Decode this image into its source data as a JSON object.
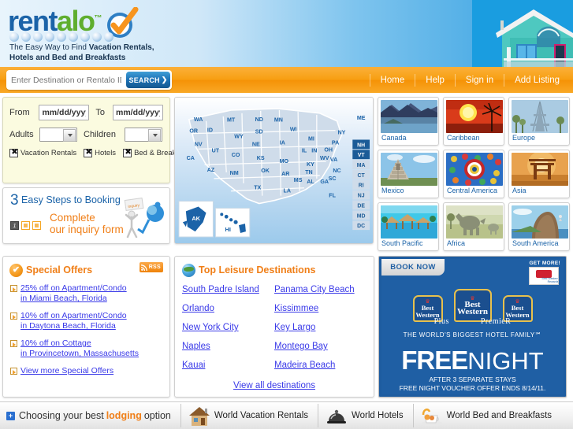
{
  "brand": {
    "logo_text_1": "rent",
    "logo_text_2": "alo",
    "logo_tm": "™",
    "tagline_line1": "The Easy Way to Find ",
    "tagline_bold1": "Vacation Rentals,",
    "tagline_line2": "Hotels and Bed and Breakfasts",
    "accent_orange": "#f07f18",
    "accent_blue": "#1b63a8",
    "accent_green": "#5fae2e",
    "link_blue": "#3a3ae8"
  },
  "nav": {
    "search_placeholder": "Enter Destination or Rentalo ID",
    "search_value": "",
    "search_button": "SEARCH",
    "search_arrow": "❯",
    "links": [
      {
        "label": "Home"
      },
      {
        "label": "Help"
      },
      {
        "label": "Sign in"
      },
      {
        "label": "Add Listing"
      }
    ]
  },
  "search_form": {
    "from_label": "From",
    "from_value": "mm/dd/yyyy",
    "to_label": "To",
    "to_value": "mm/dd/yyyy",
    "adults_label": "Adults",
    "adults_value": "",
    "children_label": "Children",
    "children_value": "",
    "checkboxes": [
      {
        "label": "Vacation Rentals",
        "checked": true
      },
      {
        "label": "Hotels",
        "checked": true
      },
      {
        "label": "Bed & Breakfast",
        "checked": true
      }
    ]
  },
  "steps": {
    "number": "3",
    "title": " Easy Steps to Booking",
    "text_line1": "Complete",
    "text_line2": "our inquiry form",
    "current_step": "1",
    "total_steps": 3,
    "art_label": "inquiry"
  },
  "map": {
    "states": [
      "WA",
      "OR",
      "ID",
      "MT",
      "ND",
      "MN",
      "WI",
      "MI",
      "NY",
      "ME",
      "WY",
      "SD",
      "IA",
      "IL",
      "IN",
      "OH",
      "PA",
      "NV",
      "NE",
      "UT",
      "CO",
      "KS",
      "MO",
      "KY",
      "WV",
      "VA",
      "NC",
      "CA",
      "AZ",
      "NM",
      "OK",
      "AR",
      "TN",
      "SC",
      "TX",
      "LA",
      "MS",
      "AL",
      "GA",
      "FL"
    ],
    "small_states": [
      "NH",
      "VT",
      "MA",
      "CT",
      "RI",
      "NJ",
      "DE",
      "MD",
      "DC"
    ],
    "insets": [
      "AK",
      "HI"
    ]
  },
  "destinations_grid": [
    {
      "label": "Canada"
    },
    {
      "label": "Caribbean"
    },
    {
      "label": "Europe"
    },
    {
      "label": "Mexico"
    },
    {
      "label": "Central America"
    },
    {
      "label": "Asia"
    },
    {
      "label": "South Pacific"
    },
    {
      "label": "Africa"
    },
    {
      "label": "South America"
    }
  ],
  "special_offers": {
    "title": "Special Offers",
    "rss_label": "RSS",
    "items": [
      {
        "line1": "25% off on Apartment/Condo",
        "line2": "in Miami Beach, Florida"
      },
      {
        "line1": "10% off on Apartment/Condo",
        "line2": "in Daytona Beach, Florida"
      },
      {
        "line1": "10% off on Cottage",
        "line2": "in Provincetown, Massachusetts"
      },
      {
        "line1": "View more Special Offers",
        "line2": ""
      }
    ]
  },
  "leisure": {
    "title": "Top Leisure Destinations",
    "col1": [
      "South Padre Island",
      "Orlando",
      "New York City",
      "Naples",
      "Kauai"
    ],
    "col2": [
      "Panama City Beach",
      "Kissimmee",
      "Key Largo",
      "Montego Bay",
      "Madeira Beach"
    ],
    "view_all": "View all destinations"
  },
  "ad": {
    "book_now": "BOOK NOW",
    "get_more": "GET MORE!",
    "rewards_label": "Best Western Rewards",
    "logo_line1": "Best",
    "logo_line2": "Western",
    "sub_left": "Plus",
    "sub_right": "PremieR",
    "family": "THE WORLD'S BIGGEST HOTEL FAMILY",
    "family_tm": "℠",
    "free": "FREE",
    "night": "NIGHT",
    "fine1": "AFTER 3 SEPARATE STAYS",
    "fine2": "FREE NIGHT VOUCHER OFFER ENDS 8/14/11.",
    "bg_color": "#1f5fa4"
  },
  "footer": {
    "lead_pre": "Choosing your best",
    "lead_highlight": "lodging",
    "lead_post": "option",
    "items": [
      {
        "label": "World Vacation Rentals",
        "icon": "house-icon"
      },
      {
        "label": "World Hotels",
        "icon": "bell-icon"
      },
      {
        "label": "World Bed and Breakfasts",
        "icon": "breakfast-icon"
      }
    ]
  }
}
